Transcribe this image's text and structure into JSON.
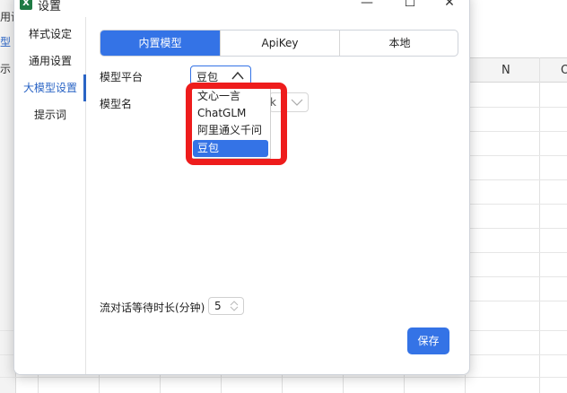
{
  "background_sheet": {
    "left_texts": [
      "用设",
      "型",
      "示"
    ],
    "column_letters": [
      "N",
      "O"
    ]
  },
  "dialog": {
    "title": "设置",
    "icon": "excel-app-icon",
    "window_buttons": {
      "minimize": "—",
      "maximize": "☐",
      "close": "✕"
    },
    "sidebar": {
      "items": [
        {
          "label": "样式设定",
          "active": false
        },
        {
          "label": "通用设置",
          "active": false
        },
        {
          "label": "大模型设置",
          "active": true
        },
        {
          "label": "提示词",
          "active": false
        }
      ]
    },
    "tabs": [
      {
        "label": "内置模型",
        "active": true
      },
      {
        "label": "ApiKey",
        "active": false
      },
      {
        "label": "本地",
        "active": false
      }
    ],
    "platform": {
      "label": "模型平台",
      "value": "豆包",
      "options": [
        "文心一言",
        "ChatGLM",
        "阿里通义千问",
        "豆包"
      ],
      "selected_index": 3
    },
    "model_name": {
      "label": "模型名",
      "value_fragment": "k"
    },
    "wait_time": {
      "label": "流对话等待时长(分钟)",
      "value": "5"
    },
    "save_label": "保存"
  },
  "colors": {
    "accent": "#3473e6",
    "highlight_border": "#ee1c1c",
    "active_nav": "#2a64c5"
  }
}
